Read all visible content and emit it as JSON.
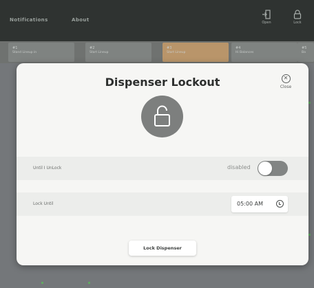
{
  "topbar": {
    "nav": [
      "Notifications",
      "About"
    ],
    "actions": [
      {
        "label": "Open",
        "icon": "open-door-icon"
      },
      {
        "label": "Lock",
        "icon": "lock-icon"
      }
    ]
  },
  "tiles": [
    {
      "num": "#1",
      "label": "Stand Lineup in"
    },
    {
      "num": "#2",
      "label": "Start Lineup"
    },
    {
      "num": "#3",
      "label": "Start Lineup"
    },
    {
      "num": "#4",
      "label": "Hi Balances"
    },
    {
      "num": "#5",
      "label": "Ba"
    }
  ],
  "modal": {
    "title": "Dispenser Lockout",
    "close_label": "Close",
    "close_icon": "close-circle-icon",
    "lock_icon": "unlocked-padlock-icon",
    "rows": {
      "until_unlock": {
        "label": "Until I UnLock",
        "toggle_state": "disabled",
        "enabled": false
      },
      "lock_until": {
        "label": "Lock Until",
        "time": "05:00 AM",
        "icon": "clock-icon"
      }
    },
    "action_label": "Lock Dispenser"
  },
  "colors": {
    "topbar": "#2f3331",
    "active_tile": "#b9956a",
    "modal_bg": "#f6f6f4",
    "lock_circle": "#7d7f7e",
    "toggle_off": "#828584"
  }
}
